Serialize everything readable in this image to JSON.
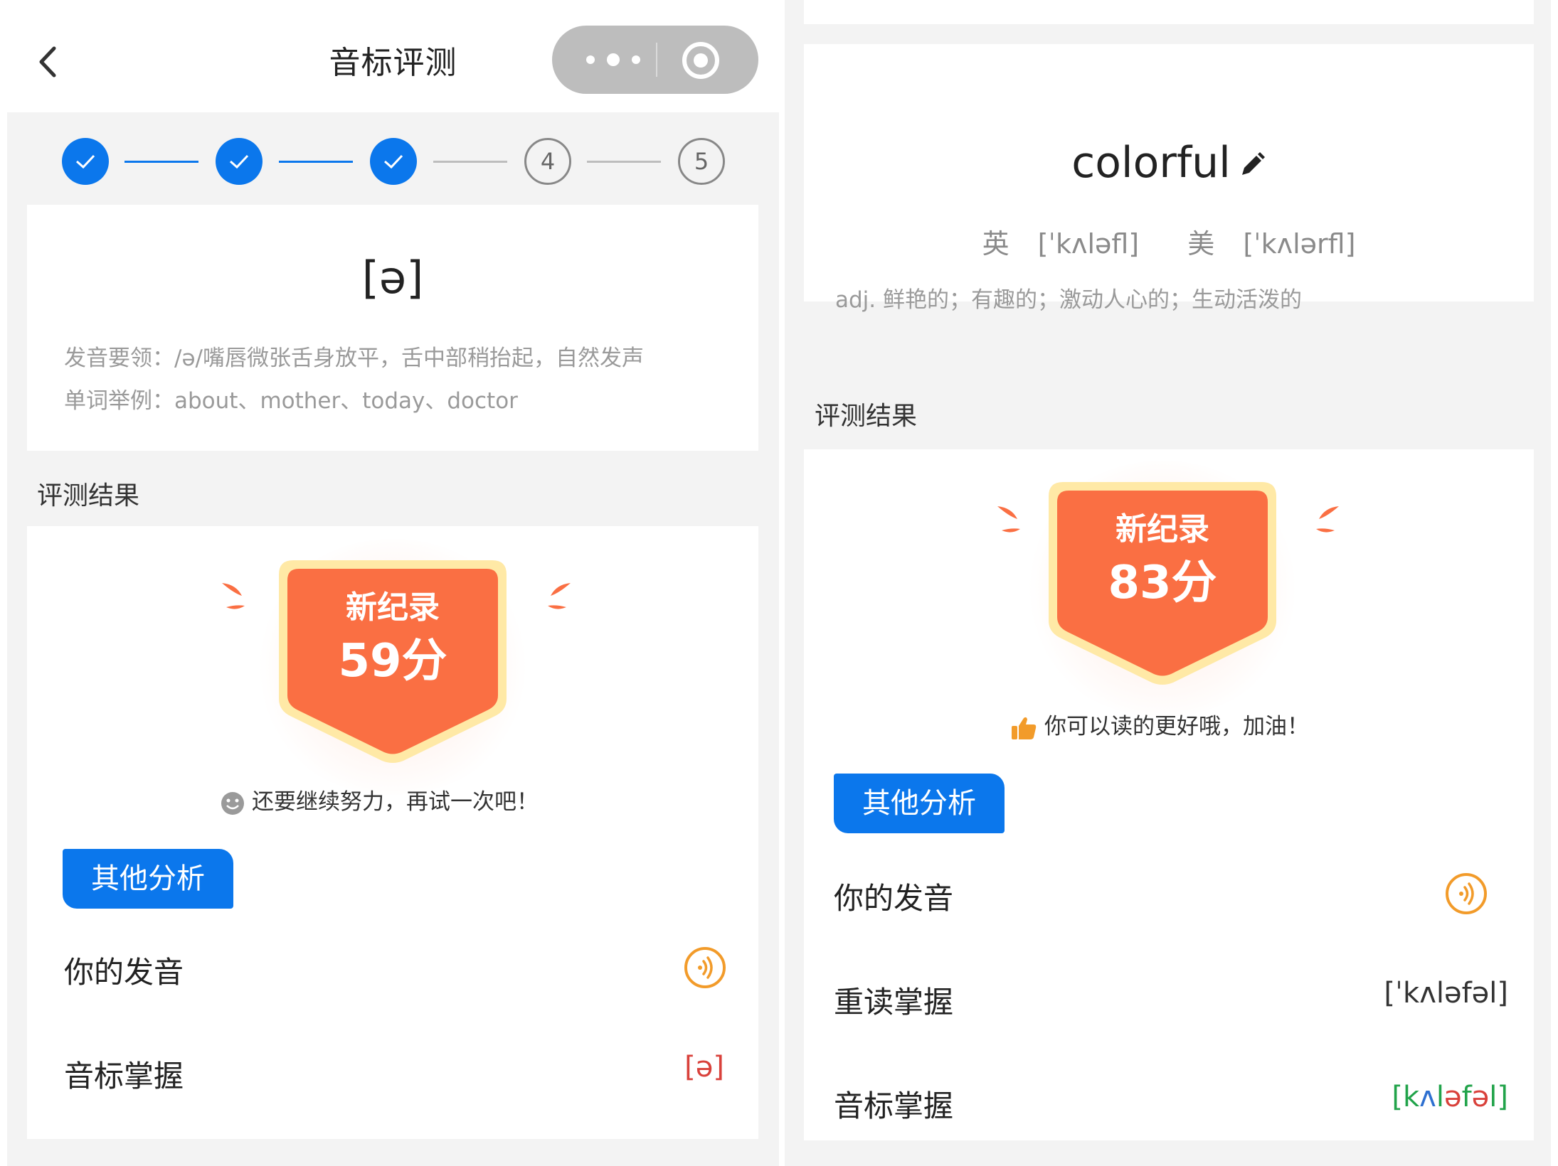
{
  "left": {
    "nav": {
      "title": "音标评测"
    },
    "steps": [
      {
        "state": "done",
        "label": ""
      },
      {
        "state": "done",
        "label": ""
      },
      {
        "state": "done",
        "label": ""
      },
      {
        "state": "todo",
        "label": "4"
      },
      {
        "state": "todo",
        "label": "5"
      }
    ],
    "phoneme": {
      "symbol": "[ə]",
      "tip": "发音要领：/ə/嘴唇微张舌身放平，舌中部稍抬起，自然发声",
      "examples": "单词举例：about、mother、today、doctor"
    },
    "section_title": "评测结果",
    "result": {
      "badge_title": "新纪录",
      "score": "59分",
      "encourage": "还要继续努力，再试一次吧！",
      "tag": "其他分析",
      "rows": [
        {
          "label": "你的发音",
          "value": ""
        },
        {
          "label": "音标掌握",
          "value": "[ə]"
        }
      ]
    }
  },
  "right": {
    "word": {
      "text": "colorful",
      "uk_label": "英",
      "uk": "[ˈkʌləfl]",
      "us_label": "美",
      "us": "[ˈkʌlərfl]",
      "meaning": "adj. 鲜艳的；有趣的；激动人心的；生动活泼的"
    },
    "section_title": "评测结果",
    "result": {
      "badge_title": "新纪录",
      "score": "83分",
      "encourage": "你可以读的更好哦，加油！",
      "tag": "其他分析",
      "rows": [
        {
          "label": "你的发音",
          "value": ""
        },
        {
          "label": "重读掌握",
          "value": "[ˈkʌləfəl]"
        },
        {
          "label": "音标掌握",
          "value": "[kʌləfəl]"
        }
      ],
      "phonetic_segments": [
        {
          "text": "[",
          "color": "green"
        },
        {
          "text": "k",
          "color": "green"
        },
        {
          "text": "ʌ",
          "color": "blue"
        },
        {
          "text": "l",
          "color": "green"
        },
        {
          "text": "ə",
          "color": "red"
        },
        {
          "text": "f",
          "color": "green"
        },
        {
          "text": "ə",
          "color": "red"
        },
        {
          "text": "l",
          "color": "green"
        },
        {
          "text": "]",
          "color": "green"
        }
      ]
    }
  },
  "colors": {
    "accent_blue": "#0b77ec",
    "badge_orange": "#fa6f43",
    "badge_border": "#ffe9a6",
    "icon_orange": "#f29b2a"
  }
}
